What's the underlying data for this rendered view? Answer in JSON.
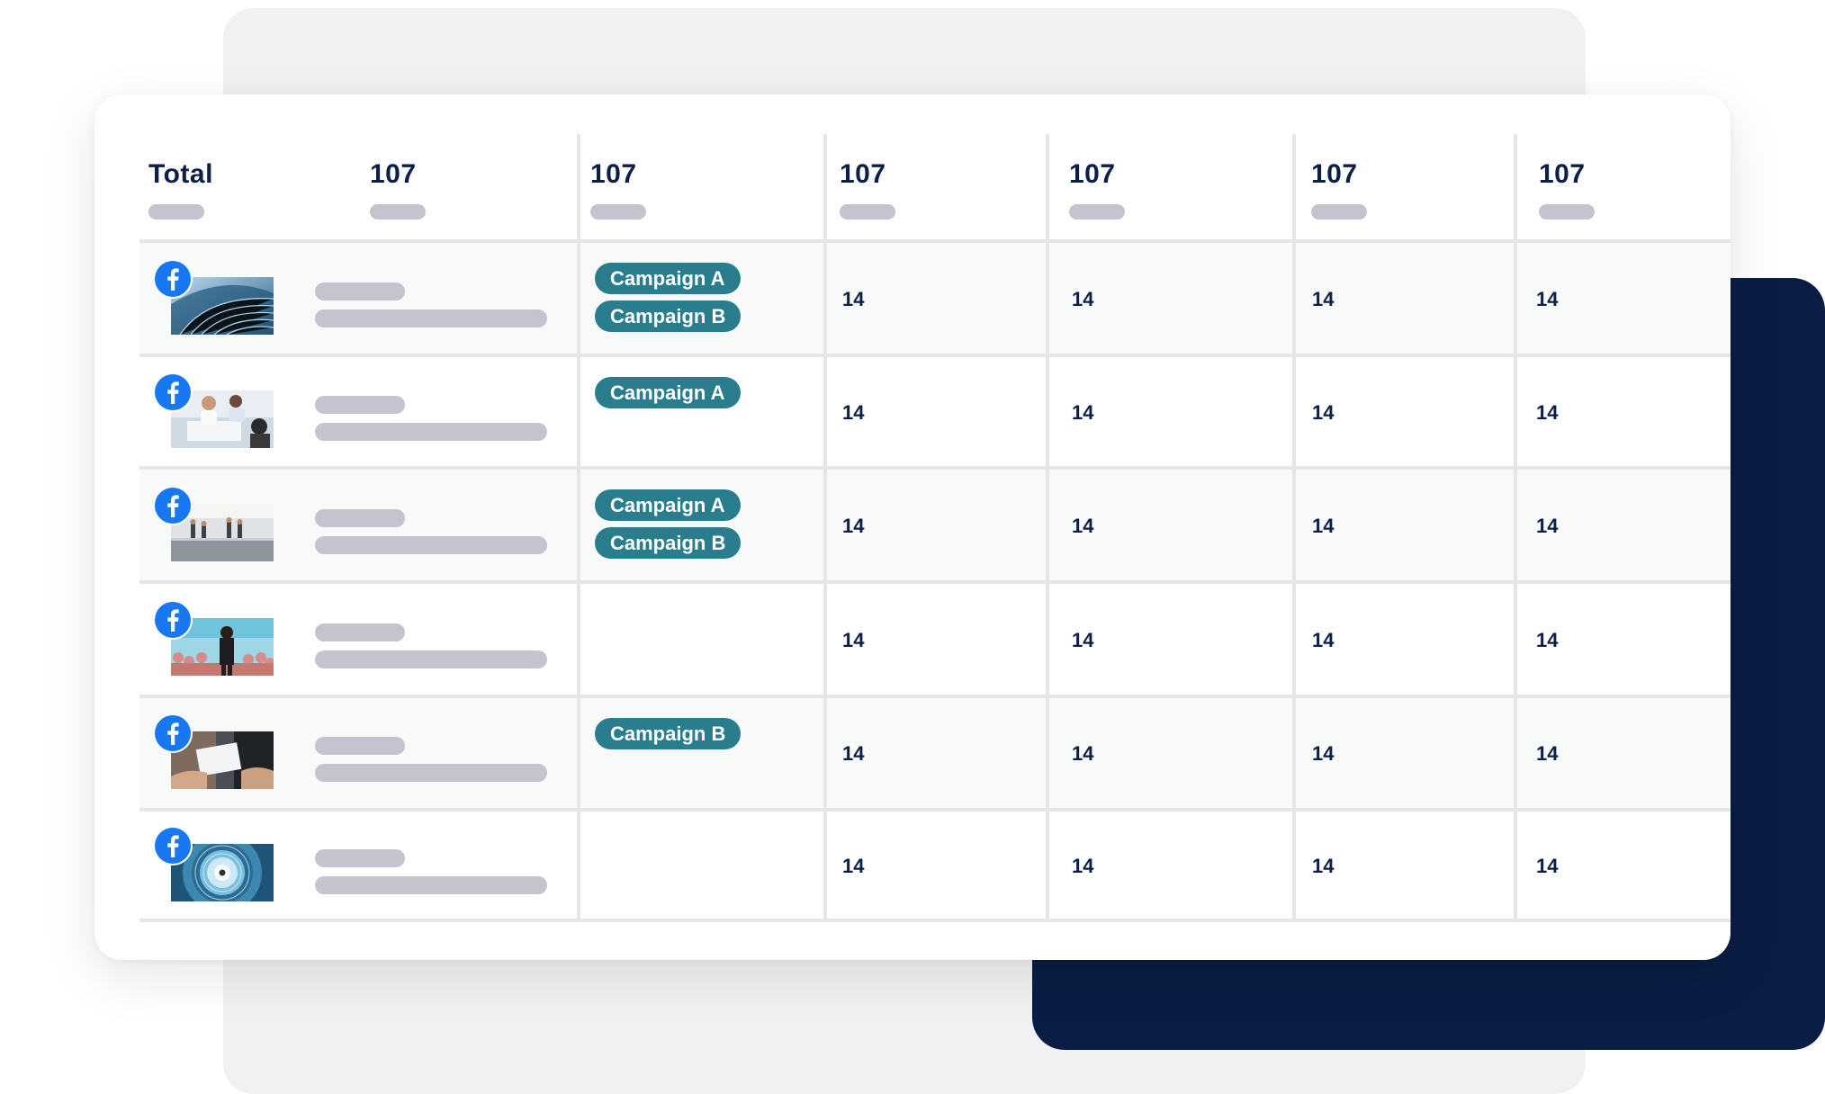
{
  "header": {
    "total_label": "Total",
    "values": [
      "107",
      "107",
      "107",
      "107",
      "107",
      "107"
    ]
  },
  "rows": [
    {
      "platform_icon": "facebook-icon",
      "thumbnail": "glass-building",
      "tags": [
        "Campaign A",
        "Campaign B"
      ],
      "metrics": [
        "14",
        "14",
        "14",
        "14"
      ]
    },
    {
      "platform_icon": "facebook-icon",
      "thumbnail": "office-meeting",
      "tags": [
        "Campaign A"
      ],
      "metrics": [
        "14",
        "14",
        "14",
        "14"
      ]
    },
    {
      "platform_icon": "facebook-icon",
      "thumbnail": "mall-balcony",
      "tags": [
        "Campaign A",
        "Campaign B"
      ],
      "metrics": [
        "14",
        "14",
        "14",
        "14"
      ]
    },
    {
      "platform_icon": "facebook-icon",
      "thumbnail": "conference-crowd",
      "tags": [],
      "metrics": [
        "14",
        "14",
        "14",
        "14"
      ]
    },
    {
      "platform_icon": "facebook-icon",
      "thumbnail": "business-handshake",
      "tags": [
        "Campaign B"
      ],
      "metrics": [
        "14",
        "14",
        "14",
        "14"
      ]
    },
    {
      "platform_icon": "facebook-icon",
      "thumbnail": "spiral-staircase",
      "tags": [],
      "metrics": [
        "14",
        "14",
        "14",
        "14"
      ]
    }
  ],
  "colors": {
    "navy": "#0b1d45",
    "tag": "#2a7d8c",
    "facebook": "#1877f2",
    "placeholder": "#c4c4ce"
  }
}
